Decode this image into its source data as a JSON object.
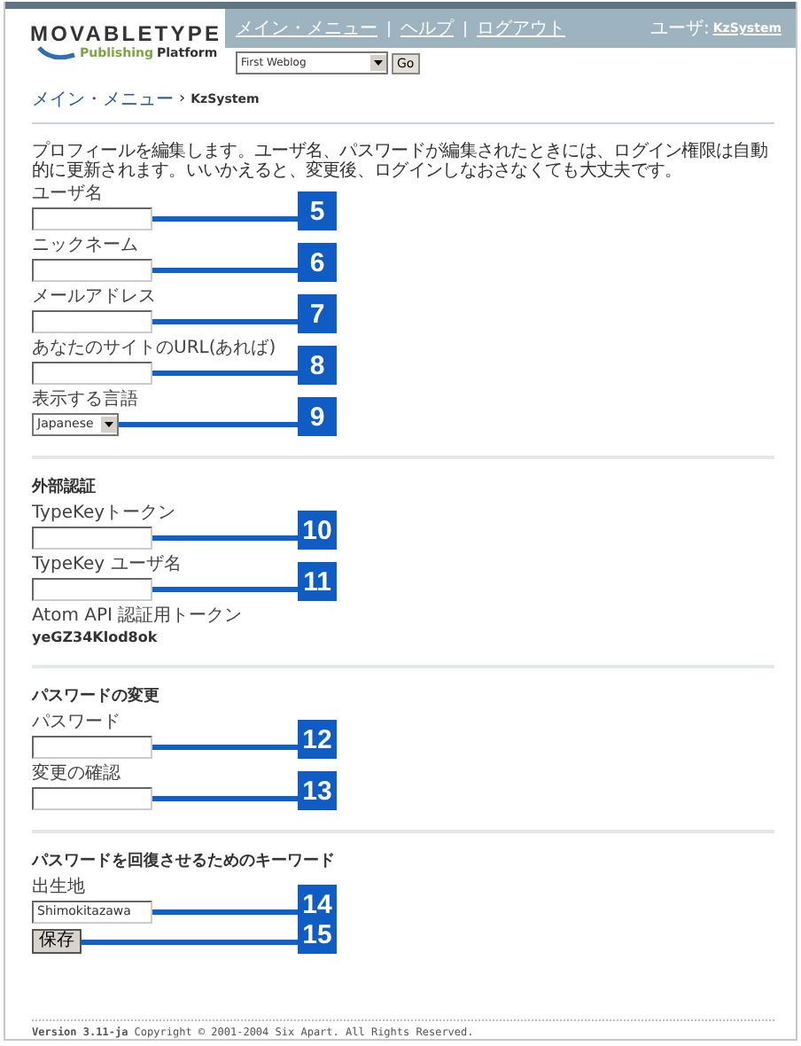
{
  "header": {
    "logo": "MOVABLETYPE",
    "logo_sub_1": "Publishing",
    "logo_sub_2": "Platform",
    "nav": [
      "メイン・メニュー",
      "ヘルプ",
      "ログアウト"
    ],
    "user_label": "ユーザ:",
    "user_name": "KzSystem",
    "blog_select": "First Weblog",
    "go_button": "Go"
  },
  "breadcrumb": {
    "link": "メイン・メニュー",
    "separator": "›",
    "current": "KzSystem"
  },
  "intro": "プロフィールを編集します。ユーザ名、パスワードが編集されたときには、ログイン権限は自動的に更新されます。いいかえると、変更後、ログインしなおさなくても大丈夫です。",
  "sections": [
    {
      "fields": [
        {
          "kind": "text",
          "label": "ユーザ名",
          "callout": "5"
        },
        {
          "kind": "text",
          "label": "ニックネーム",
          "callout": "6"
        },
        {
          "kind": "text",
          "label": "メールアドレス",
          "callout": "7"
        },
        {
          "kind": "text",
          "label": "あなたのサイトのURL(あれば)",
          "callout": "8"
        },
        {
          "kind": "select",
          "label": "表示する言語",
          "value": "Japanese",
          "callout": "9"
        }
      ]
    },
    {
      "title": "外部認証",
      "fields": [
        {
          "kind": "text",
          "label": "TypeKeyトークン",
          "callout": "10"
        },
        {
          "kind": "text",
          "label": "TypeKey ユーザ名",
          "callout": "11"
        },
        {
          "kind": "static",
          "label": "Atom API 認証用トークン",
          "value": "yeGZ34Klod8ok"
        }
      ]
    },
    {
      "title": "パスワードの変更",
      "fields": [
        {
          "kind": "text",
          "label": "パスワード",
          "callout": "12"
        },
        {
          "kind": "text",
          "label": "変更の確認",
          "callout": "13"
        }
      ]
    },
    {
      "title": "パスワードを回復させるためのキーワード",
      "fields": [
        {
          "kind": "text",
          "label": "出生地",
          "value": "Shimokitazawa",
          "callout": "14"
        },
        {
          "kind": "button",
          "label": "保存",
          "callout": "15"
        }
      ]
    }
  ],
  "footer": "**Version 3.11-ja** Copyright © 2001-2004 Six Apart. All Rights Reserved."
}
